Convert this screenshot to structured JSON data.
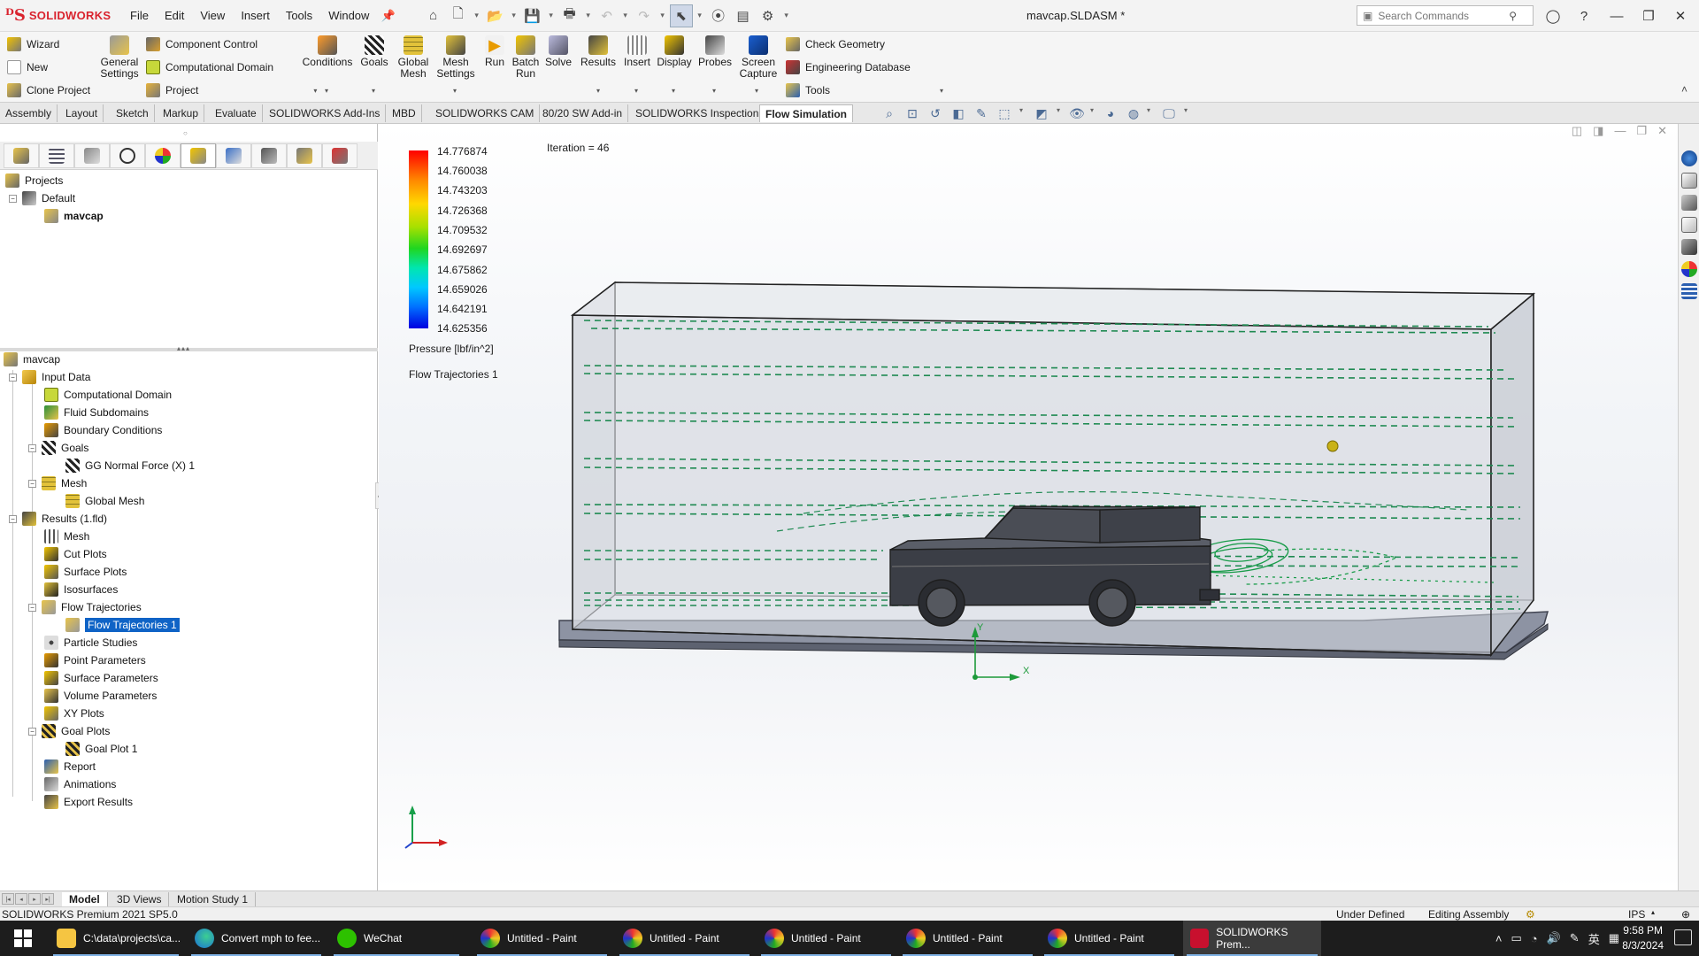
{
  "app": {
    "brand": "SOLIDWORKS",
    "document_title": "mavcap.SLDASM *",
    "menu": [
      "File",
      "Edit",
      "View",
      "Insert",
      "Tools",
      "Window"
    ],
    "search_placeholder": "Search Commands"
  },
  "command_manager": {
    "left_items": [
      "Wizard",
      "New",
      "Clone Project"
    ],
    "general_settings": "General Settings",
    "component_control": "Component Control",
    "computational_domain": "Computational Domain",
    "project": "Project",
    "big_buttons": [
      "Conditions",
      "Goals",
      "Global Mesh",
      "Mesh Settings",
      "Run",
      "Batch Run",
      "Solve",
      "Results",
      "Insert",
      "Display",
      "Probes",
      "Screen Capture"
    ],
    "right_items": [
      "Check Geometry",
      "Engineering Database",
      "Tools"
    ],
    "tabs": [
      "Assembly",
      "Layout",
      "Sketch",
      "Markup",
      "Evaluate",
      "SOLIDWORKS Add-Ins",
      "MBD",
      "SOLIDWORKS CAM",
      "80/20 SW Add-in",
      "SOLIDWORKS Inspection",
      "Flow Simulation"
    ],
    "active_tab": "Flow Simulation"
  },
  "projects_tree": {
    "root": "Projects",
    "config": "Default",
    "project": "mavcap"
  },
  "analysis_tree": {
    "root": "mavcap",
    "input_data": "Input Data",
    "computational_domain": "Computational Domain",
    "fluid_subdomains": "Fluid Subdomains",
    "boundary_conditions": "Boundary Conditions",
    "goals": "Goals",
    "goal_item": "GG Normal Force (X) 1",
    "mesh": "Mesh",
    "global_mesh": "Global Mesh",
    "results": "Results (1.fld)",
    "results_mesh": "Mesh",
    "cut_plots": "Cut Plots",
    "surface_plots": "Surface Plots",
    "isosurfaces": "Isosurfaces",
    "flow_trajectories": "Flow Trajectories",
    "flow_trajectories_1": "Flow Trajectories 1",
    "particle_studies": "Particle Studies",
    "point_parameters": "Point Parameters",
    "surface_parameters": "Surface Parameters",
    "volume_parameters": "Volume Parameters",
    "xy_plots": "XY Plots",
    "goal_plots": "Goal Plots",
    "goal_plot_1": "Goal Plot 1",
    "report": "Report",
    "animations": "Animations",
    "export_results": "Export Results"
  },
  "viewport": {
    "iteration": "Iteration = 46",
    "legend_values": [
      "14.776874",
      "14.760038",
      "14.743203",
      "14.726368",
      "14.709532",
      "14.692697",
      "14.675862",
      "14.659026",
      "14.642191",
      "14.625356"
    ],
    "legend_unit": "Pressure [lbf/in^2]",
    "legend_plot": "Flow Trajectories 1",
    "axis_y": "Y",
    "axis_x": "X"
  },
  "bottom_tabs": [
    "Model",
    "3D Views",
    "Motion Study 1"
  ],
  "status": {
    "product": "SOLIDWORKS Premium 2021 SP5.0",
    "state": "Under Defined",
    "mode": "Editing Assembly",
    "units": "IPS"
  },
  "taskbar": {
    "items": [
      "C:\\data\\projects\\ca...",
      "Convert mph to fee...",
      "WeChat",
      "Untitled - Paint",
      "Untitled - Paint",
      "Untitled - Paint",
      "Untitled - Paint",
      "Untitled - Paint",
      "SOLIDWORKS Prem..."
    ],
    "ime": "英",
    "time": "9:58 PM",
    "date": "8/3/2024"
  }
}
